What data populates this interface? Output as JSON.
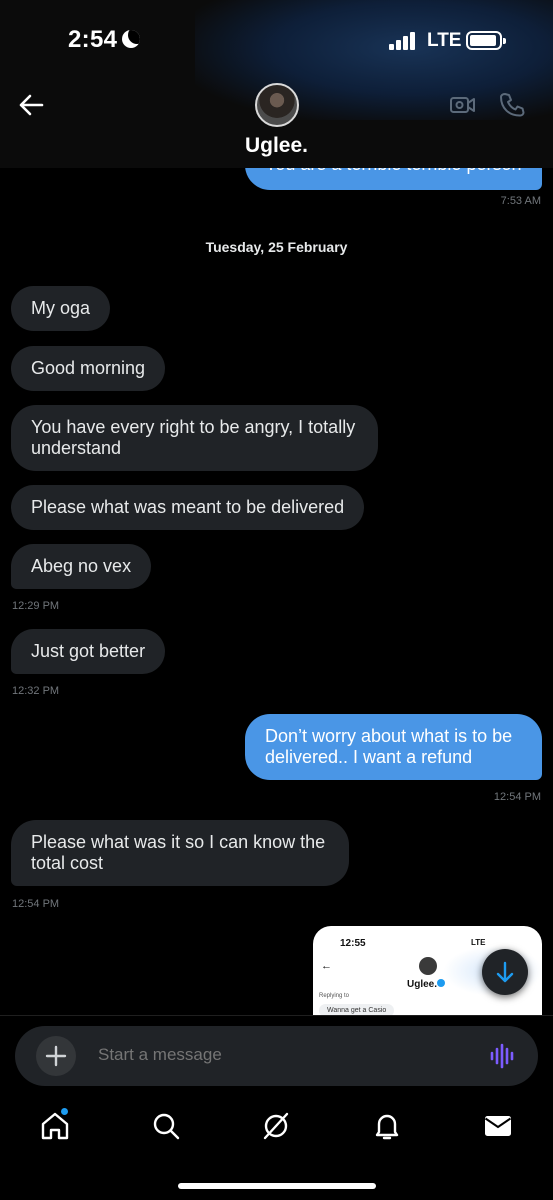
{
  "status_bar": {
    "time": "2:54",
    "network": "LTE"
  },
  "header": {
    "contact_name": "Uglee."
  },
  "messages": {
    "prev_out_fragment": "You are a terrible terrible person",
    "prev_out_time": "7:53 AM",
    "date_separator": "Tuesday, 25 February",
    "m1": "My oga",
    "m2": "Good morning",
    "m3": "You have every right to be angry, I totally understand",
    "m4": "Please what was meant to be delivered",
    "m5": "Abeg no vex",
    "m5_time": "12:29 PM",
    "m6": "Just got better",
    "m6_time": "12:32 PM",
    "m7": "Don’t worry about what is to be delivered.. I want a refund",
    "m7_time": "12:54 PM",
    "m8": "Please what was it so I can know the total cost",
    "m8_time": "12:54 PM"
  },
  "preview": {
    "time": "12:55",
    "network": "LTE",
    "name": "Uglee.",
    "replying": "Replying to",
    "bubble": "Wanna get a Casio"
  },
  "composer": {
    "placeholder": "Start a message"
  },
  "colors": {
    "accent": "#1d9bf0",
    "out_bubble": "#4a96e6",
    "in_bubble": "#202327",
    "voice": "#7c5cff"
  },
  "tabs": [
    "home-icon",
    "search-icon",
    "grok-icon",
    "notifications-icon",
    "messages-icon"
  ]
}
